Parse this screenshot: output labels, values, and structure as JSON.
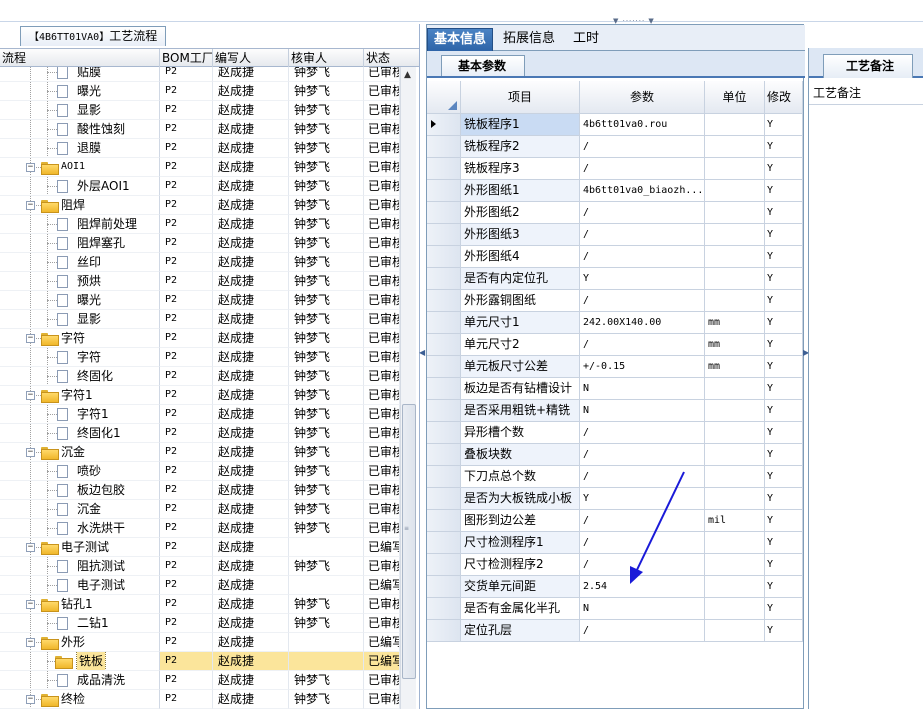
{
  "left_panel": {
    "tab_code": "【4B6TT01VA0】",
    "tab_title": "工艺流程",
    "columns": [
      "流程",
      "BOM工厂",
      "编写人",
      "核审人",
      "状态"
    ],
    "rows": [
      {
        "level": 2,
        "kind": "doc",
        "name": "贴膜",
        "bom": "P2",
        "editor": "赵成捷",
        "reviewer": "钟梦飞",
        "status": "已审核"
      },
      {
        "level": 2,
        "kind": "doc",
        "name": "曝光",
        "bom": "P2",
        "editor": "赵成捷",
        "reviewer": "钟梦飞",
        "status": "已审核"
      },
      {
        "level": 2,
        "kind": "doc",
        "name": "显影",
        "bom": "P2",
        "editor": "赵成捷",
        "reviewer": "钟梦飞",
        "status": "已审核"
      },
      {
        "level": 2,
        "kind": "doc",
        "name": "酸性蚀刻",
        "bom": "P2",
        "editor": "赵成捷",
        "reviewer": "钟梦飞",
        "status": "已审核"
      },
      {
        "level": 2,
        "kind": "doc",
        "name": "退膜",
        "bom": "P2",
        "editor": "赵成捷",
        "reviewer": "钟梦飞",
        "status": "已审核"
      },
      {
        "level": 1,
        "kind": "folder",
        "name": "AOI1",
        "bom": "P2",
        "editor": "赵成捷",
        "reviewer": "钟梦飞",
        "status": "已审核"
      },
      {
        "level": 2,
        "kind": "doc",
        "name": "外层AOI1",
        "bom": "P2",
        "editor": "赵成捷",
        "reviewer": "钟梦飞",
        "status": "已审核"
      },
      {
        "level": 1,
        "kind": "folder",
        "name": "阻焊",
        "bom": "P2",
        "editor": "赵成捷",
        "reviewer": "钟梦飞",
        "status": "已审核"
      },
      {
        "level": 2,
        "kind": "doc",
        "name": "阻焊前处理",
        "bom": "P2",
        "editor": "赵成捷",
        "reviewer": "钟梦飞",
        "status": "已审核"
      },
      {
        "level": 2,
        "kind": "doc",
        "name": "阻焊塞孔",
        "bom": "P2",
        "editor": "赵成捷",
        "reviewer": "钟梦飞",
        "status": "已审核"
      },
      {
        "level": 2,
        "kind": "doc",
        "name": "丝印",
        "bom": "P2",
        "editor": "赵成捷",
        "reviewer": "钟梦飞",
        "status": "已审核"
      },
      {
        "level": 2,
        "kind": "doc",
        "name": "预烘",
        "bom": "P2",
        "editor": "赵成捷",
        "reviewer": "钟梦飞",
        "status": "已审核"
      },
      {
        "level": 2,
        "kind": "doc",
        "name": "曝光",
        "bom": "P2",
        "editor": "赵成捷",
        "reviewer": "钟梦飞",
        "status": "已审核"
      },
      {
        "level": 2,
        "kind": "doc",
        "name": "显影",
        "bom": "P2",
        "editor": "赵成捷",
        "reviewer": "钟梦飞",
        "status": "已审核"
      },
      {
        "level": 1,
        "kind": "folder",
        "name": "字符",
        "bom": "P2",
        "editor": "赵成捷",
        "reviewer": "钟梦飞",
        "status": "已审核"
      },
      {
        "level": 2,
        "kind": "doc",
        "name": "字符",
        "bom": "P2",
        "editor": "赵成捷",
        "reviewer": "钟梦飞",
        "status": "已审核"
      },
      {
        "level": 2,
        "kind": "doc",
        "name": "终固化",
        "bom": "P2",
        "editor": "赵成捷",
        "reviewer": "钟梦飞",
        "status": "已审核"
      },
      {
        "level": 1,
        "kind": "folder",
        "name": "字符1",
        "bom": "P2",
        "editor": "赵成捷",
        "reviewer": "钟梦飞",
        "status": "已审核"
      },
      {
        "level": 2,
        "kind": "doc",
        "name": "字符1",
        "bom": "P2",
        "editor": "赵成捷",
        "reviewer": "钟梦飞",
        "status": "已审核"
      },
      {
        "level": 2,
        "kind": "doc",
        "name": "终固化1",
        "bom": "P2",
        "editor": "赵成捷",
        "reviewer": "钟梦飞",
        "status": "已审核"
      },
      {
        "level": 1,
        "kind": "folder",
        "name": "沉金",
        "bom": "P2",
        "editor": "赵成捷",
        "reviewer": "钟梦飞",
        "status": "已审核"
      },
      {
        "level": 2,
        "kind": "doc",
        "name": "喷砂",
        "bom": "P2",
        "editor": "赵成捷",
        "reviewer": "钟梦飞",
        "status": "已审核"
      },
      {
        "level": 2,
        "kind": "doc",
        "name": "板边包胶",
        "bom": "P2",
        "editor": "赵成捷",
        "reviewer": "钟梦飞",
        "status": "已审核"
      },
      {
        "level": 2,
        "kind": "doc",
        "name": "沉金",
        "bom": "P2",
        "editor": "赵成捷",
        "reviewer": "钟梦飞",
        "status": "已审核"
      },
      {
        "level": 2,
        "kind": "doc",
        "name": "水洗烘干",
        "bom": "P2",
        "editor": "赵成捷",
        "reviewer": "钟梦飞",
        "status": "已审核"
      },
      {
        "level": 1,
        "kind": "folder",
        "name": "电子测试",
        "bom": "P2",
        "editor": "赵成捷",
        "reviewer": "",
        "status": "已编写"
      },
      {
        "level": 2,
        "kind": "doc",
        "name": "阻抗测试",
        "bom": "P2",
        "editor": "赵成捷",
        "reviewer": "钟梦飞",
        "status": "已审核"
      },
      {
        "level": 2,
        "kind": "doc",
        "name": "电子测试",
        "bom": "P2",
        "editor": "赵成捷",
        "reviewer": "",
        "status": "已编写"
      },
      {
        "level": 1,
        "kind": "folder",
        "name": "钻孔1",
        "bom": "P2",
        "editor": "赵成捷",
        "reviewer": "钟梦飞",
        "status": "已审核"
      },
      {
        "level": 2,
        "kind": "doc",
        "name": "二钻1",
        "bom": "P2",
        "editor": "赵成捷",
        "reviewer": "钟梦飞",
        "status": "已审核"
      },
      {
        "level": 1,
        "kind": "folder",
        "name": "外形",
        "bom": "P2",
        "editor": "赵成捷",
        "reviewer": "",
        "status": "已编写"
      },
      {
        "level": 2,
        "kind": "folder",
        "name": "铣板",
        "bom": "P2",
        "editor": "赵成捷",
        "reviewer": "",
        "status": "已编写",
        "selected": true
      },
      {
        "level": 2,
        "kind": "doc",
        "name": "成品清洗",
        "bom": "P2",
        "editor": "赵成捷",
        "reviewer": "钟梦飞",
        "status": "已审核"
      },
      {
        "level": 1,
        "kind": "folder",
        "name": "终检",
        "bom": "P2",
        "editor": "赵成捷",
        "reviewer": "钟梦飞",
        "status": "已审核"
      }
    ]
  },
  "middle_panel": {
    "tabs": [
      "基本信息",
      "拓展信息",
      "工时"
    ],
    "active_tab": "基本信息",
    "subtab": "基本参数",
    "columns": [
      "项目",
      "参数",
      "单位",
      "修改"
    ],
    "rows": [
      {
        "item": "铣板程序1",
        "param": "4b6tt01va0.rou",
        "unit": "",
        "mod": "Y"
      },
      {
        "item": "铣板程序2",
        "param": "/",
        "unit": "",
        "mod": "Y"
      },
      {
        "item": "铣板程序3",
        "param": "/",
        "unit": "",
        "mod": "Y"
      },
      {
        "item": "外形图纸1",
        "param": "4b6tt01va0_biaozh...",
        "unit": "",
        "mod": "Y"
      },
      {
        "item": "外形图纸2",
        "param": "/",
        "unit": "",
        "mod": "Y"
      },
      {
        "item": "外形图纸3",
        "param": "/",
        "unit": "",
        "mod": "Y"
      },
      {
        "item": "外形图纸4",
        "param": "/",
        "unit": "",
        "mod": "Y"
      },
      {
        "item": "是否有内定位孔",
        "param": "Y",
        "unit": "",
        "mod": "Y"
      },
      {
        "item": "外形露铜图纸",
        "param": "/",
        "unit": "",
        "mod": "Y"
      },
      {
        "item": "单元尺寸1",
        "param": "242.00X140.00",
        "unit": "mm",
        "mod": "Y"
      },
      {
        "item": "单元尺寸2",
        "param": "/",
        "unit": "mm",
        "mod": "Y"
      },
      {
        "item": "单元板尺寸公差",
        "param": "+/-0.15",
        "unit": "mm",
        "mod": "Y"
      },
      {
        "item": "板边是否有钻槽设计",
        "param": "N",
        "unit": "",
        "mod": "Y"
      },
      {
        "item": "是否采用粗铣+精铣",
        "param": "N",
        "unit": "",
        "mod": "Y"
      },
      {
        "item": "异形槽个数",
        "param": "/",
        "unit": "",
        "mod": "Y"
      },
      {
        "item": "叠板块数",
        "param": "/",
        "unit": "",
        "mod": "Y"
      },
      {
        "item": "下刀点总个数",
        "param": "/",
        "unit": "",
        "mod": "Y"
      },
      {
        "item": "是否为大板铣成小板",
        "param": "Y",
        "unit": "",
        "mod": "Y"
      },
      {
        "item": "图形到边公差",
        "param": "/",
        "unit": "mil",
        "mod": "Y"
      },
      {
        "item": "尺寸检测程序1",
        "param": "/",
        "unit": "",
        "mod": "Y"
      },
      {
        "item": "尺寸检测程序2",
        "param": "/",
        "unit": "",
        "mod": "Y"
      },
      {
        "item": "交货单元间距",
        "param": "2.54",
        "unit": "",
        "mod": "Y"
      },
      {
        "item": "是否有金属化半孔",
        "param": "N",
        "unit": "",
        "mod": "Y"
      },
      {
        "item": "定位孔层",
        "param": "/",
        "unit": "",
        "mod": "Y"
      }
    ]
  },
  "right_panel": {
    "tab": "工艺备注",
    "label": "工艺备注"
  },
  "colors": {
    "accent": "#2d64a8",
    "selection": "#fbe59b",
    "annotation_arrow": "#1a1ad8"
  },
  "icons": [
    "folder-icon",
    "document-icon",
    "expand-collapse-icon",
    "row-pointer-icon",
    "scroll-up-icon",
    "splitter-grip-icon"
  ]
}
